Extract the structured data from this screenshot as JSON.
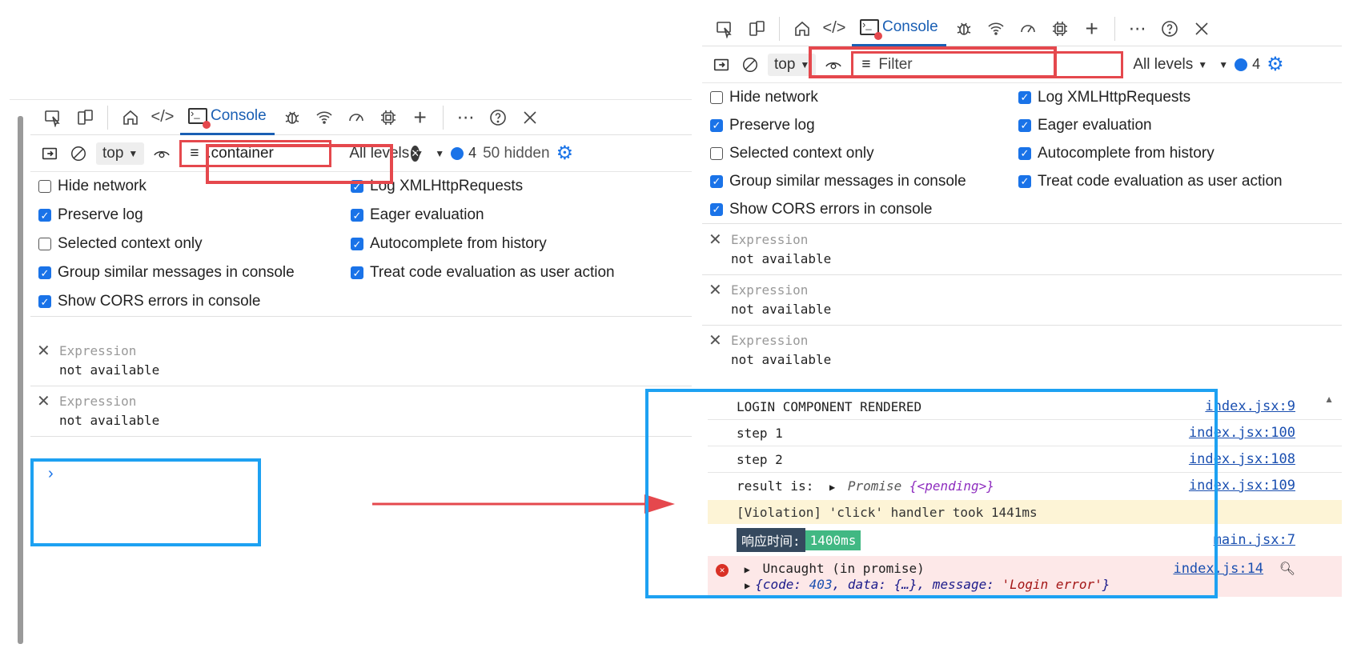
{
  "toolbar": {
    "console_label": "Console"
  },
  "filter_left": {
    "context": "top",
    "filter_value": ".container",
    "levels": "All levels",
    "message_count": "4",
    "hidden": "50 hidden"
  },
  "filter_right": {
    "context": "top",
    "placeholder": "Filter",
    "levels": "All levels",
    "message_count": "4"
  },
  "settings": {
    "left_col": [
      {
        "label": "Hide network",
        "checked": false
      },
      {
        "label": "Preserve log",
        "checked": true
      },
      {
        "label": "Selected context only",
        "checked": false
      },
      {
        "label": "Group similar messages in console",
        "checked": true
      },
      {
        "label": "Show CORS errors in console",
        "checked": true
      }
    ],
    "right_col": [
      {
        "label": "Log XMLHttpRequests",
        "checked": true
      },
      {
        "label": "Eager evaluation",
        "checked": true
      },
      {
        "label": "Autocomplete from history",
        "checked": true
      },
      {
        "label": "Treat code evaluation as user action",
        "checked": true
      }
    ]
  },
  "expressions": {
    "label": "Expression",
    "value": "not available"
  },
  "prompt": "›",
  "logs": {
    "l1": {
      "text": "LOGIN COMPONENT RENDERED",
      "src": "index.jsx:9"
    },
    "l2": {
      "text": "step 1",
      "src": "index.jsx:100"
    },
    "l3": {
      "text": "step 2",
      "src": "index.jsx:108"
    },
    "l4": {
      "prefix": "result is:",
      "promise": "Promise",
      "state": "{<pending>}",
      "src": "index.jsx:109"
    },
    "violation": "[Violation] 'click' handler took 1441ms",
    "resp": {
      "key": "响应时间:",
      "val": "1400ms",
      "src": "main.jsx:7"
    },
    "error": {
      "text": "Uncaught (in promise)",
      "src": "index.js:14",
      "obj_open": "{code: ",
      "code": "403",
      "obj_mid": ", data: {…}, message: ",
      "message": "'Login error'",
      "obj_close": "}"
    }
  },
  "colors": {
    "accent": "#1a73e8",
    "highlight_red": "#e5484d",
    "highlight_blue": "#1da1f2"
  }
}
